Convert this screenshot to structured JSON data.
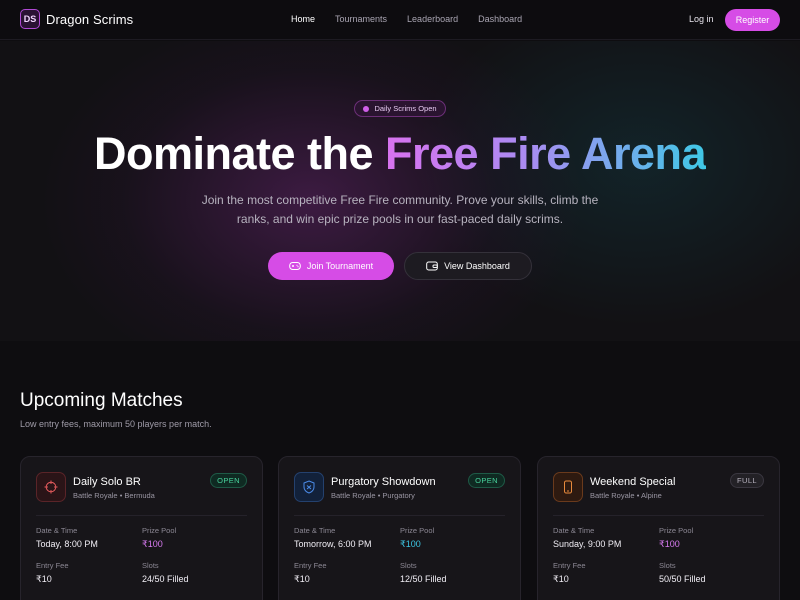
{
  "nav": {
    "logo": "DS",
    "brand": "Dragon Scrims",
    "links": [
      "Home",
      "Tournaments",
      "Leaderboard",
      "Dashboard"
    ],
    "login": "Log in",
    "register": "Register"
  },
  "hero": {
    "badge": "Daily Scrims Open",
    "title_plain": "Dominate the ",
    "title_gradient": "Free Fire Arena",
    "subtitle": "Join the most competitive Free Fire community. Prove your skills, climb the ranks, and win epic prize pools in our fast-paced daily scrims.",
    "join_label": "Join Tournament",
    "dashboard_label": "View Dashboard"
  },
  "section": {
    "title": "Upcoming Matches",
    "subtitle": "Low entry fees, maximum 50 players per match."
  },
  "labels": {
    "date_time": "Date & Time",
    "prize_pool": "Prize Pool",
    "entry_fee": "Entry Fee",
    "slots": "Slots"
  },
  "matches": [
    {
      "name": "Daily Solo BR",
      "meta": "Battle Royale • Bermuda",
      "status": "OPEN",
      "date_time": "Today, 8:00 PM",
      "prize_pool": "₹100",
      "entry_fee": "₹10",
      "slots": "24/50 Filled",
      "icon": "crosshair-icon",
      "accent": "#e0595b"
    },
    {
      "name": "Purgatory Showdown",
      "meta": "Battle Royale • Purgatory",
      "status": "OPEN",
      "date_time": "Tomorrow, 6:00 PM",
      "prize_pool": "₹100",
      "entry_fee": "₹10",
      "slots": "12/50 Filled",
      "icon": "shield-icon",
      "accent": "#4b8be8"
    },
    {
      "name": "Weekend Special",
      "meta": "Battle Royale • Alpine",
      "status": "FULL",
      "date_time": "Sunday, 9:00 PM",
      "prize_pool": "₹100",
      "entry_fee": "₹10",
      "slots": "50/50 Filled",
      "icon": "phone-icon",
      "accent": "#e88a3c"
    }
  ],
  "colors": {
    "primary": "#d64ce6",
    "open_green": "#49d29c",
    "cyan": "#3cc6e4"
  }
}
